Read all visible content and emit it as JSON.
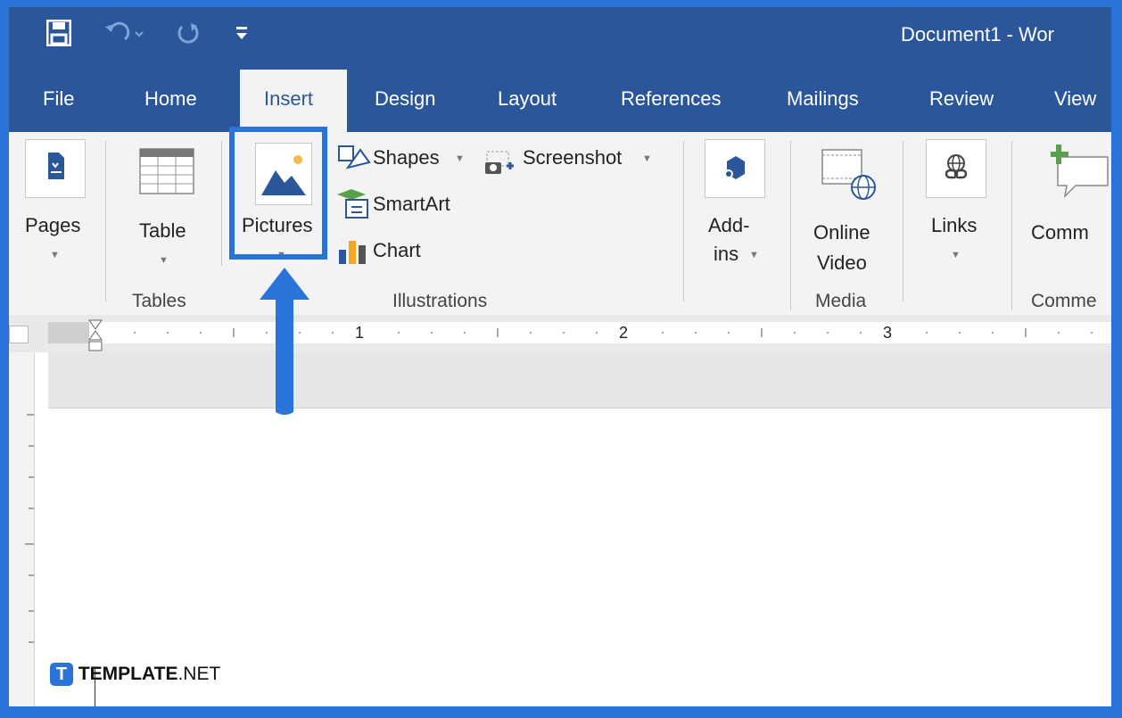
{
  "window": {
    "title": "Document1 - Wor"
  },
  "quick_access": {
    "save_icon": "save-icon",
    "undo_icon": "undo-icon",
    "redo_icon": "redo-icon",
    "customize_icon": "customize-quick-access-icon"
  },
  "tabs": [
    {
      "label": "File"
    },
    {
      "label": "Home"
    },
    {
      "label": "Insert",
      "active": true
    },
    {
      "label": "Design"
    },
    {
      "label": "Layout"
    },
    {
      "label": "References"
    },
    {
      "label": "Mailings"
    },
    {
      "label": "Review"
    },
    {
      "label": "View"
    }
  ],
  "ribbon": {
    "pages": {
      "label": "Pages"
    },
    "table": {
      "label": "Table"
    },
    "pictures": {
      "label": "Pictures"
    },
    "shapes": {
      "label": "Shapes"
    },
    "screenshot": {
      "label": "Screenshot"
    },
    "smartart": {
      "label": "SmartArt"
    },
    "chart": {
      "label": "Chart"
    },
    "addins": {
      "label_line1": "Add-",
      "label_line2": "ins"
    },
    "online_video": {
      "label_line1": "Online",
      "label_line2": "Video"
    },
    "links": {
      "label": "Links"
    },
    "comment": {
      "label": "Comm"
    },
    "groups": {
      "tables": "Tables",
      "illustrations": "Illustrations",
      "media": "Media",
      "comments": "Comme"
    }
  },
  "ruler": {
    "numbers": [
      "1",
      "2",
      "3"
    ]
  },
  "watermark": {
    "bold": "TEMPLATE",
    "rest": ".NET",
    "logo_letter": "T"
  },
  "colors": {
    "title_bar": "#2b579a",
    "highlight": "#2a74d9",
    "frame": "#2b72d8"
  }
}
